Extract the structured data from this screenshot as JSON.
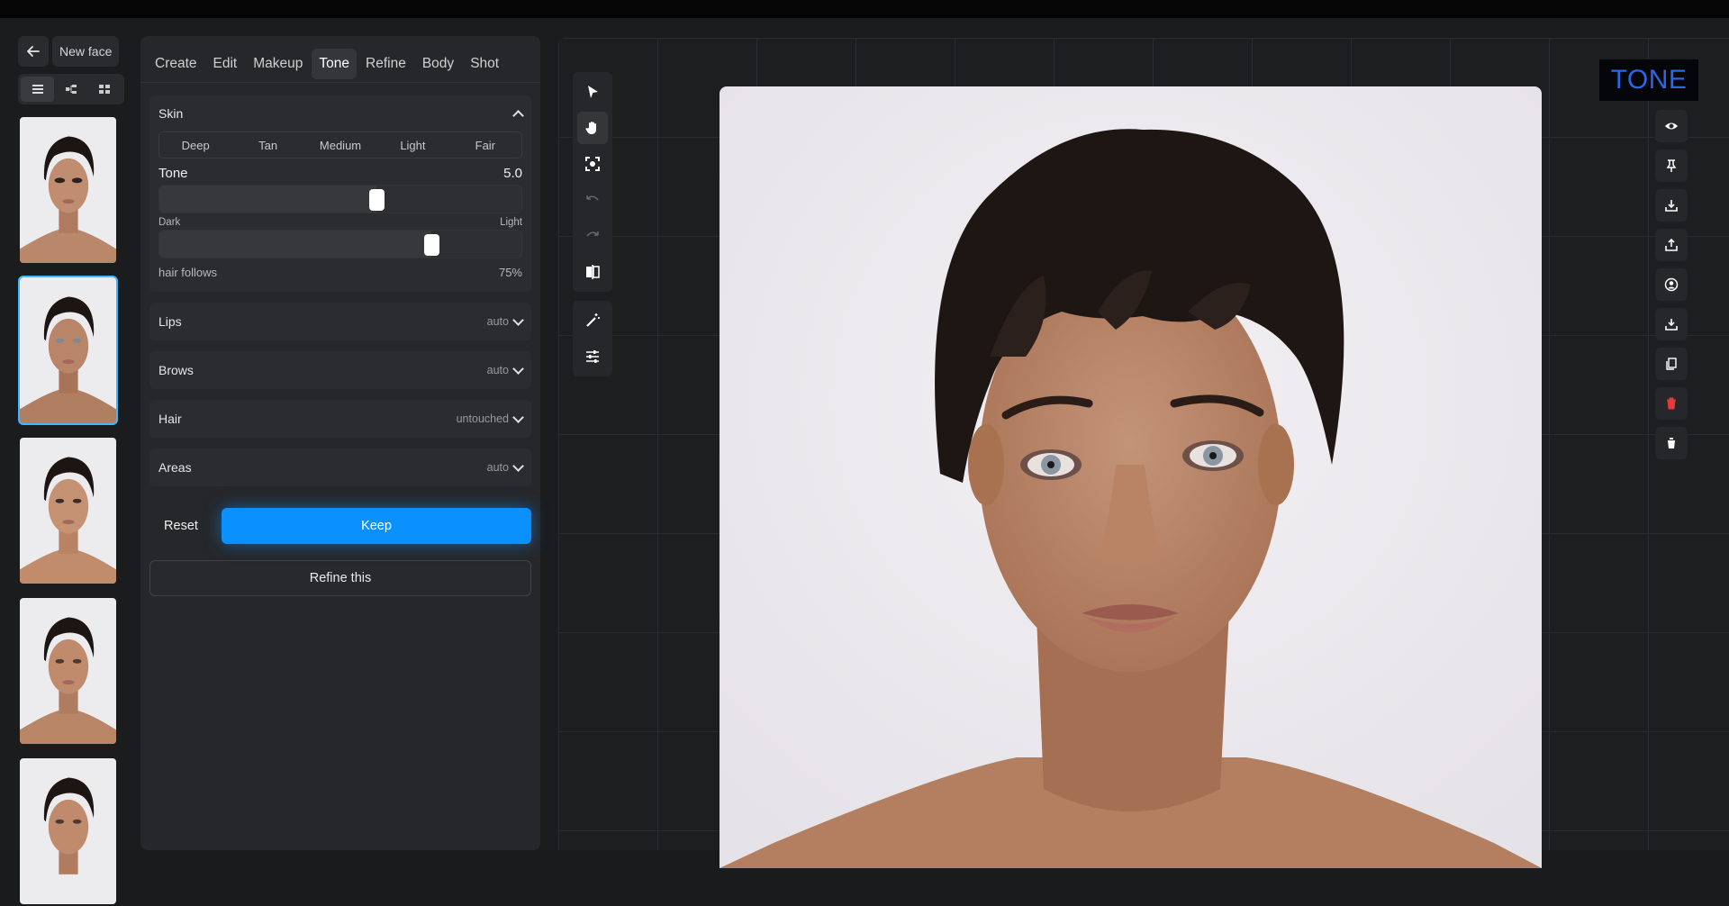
{
  "header": {
    "back_icon": "arrow-left-icon",
    "title": "New face"
  },
  "view_modes": [
    "list-view-icon",
    "tree-view-icon",
    "grid-view-icon"
  ],
  "thumbnails": [
    {
      "selected": false,
      "variant": "heavy eye makeup"
    },
    {
      "selected": true,
      "variant": "tone edit"
    },
    {
      "selected": false,
      "variant": "warm"
    },
    {
      "selected": false,
      "variant": "natural"
    },
    {
      "selected": false,
      "variant": "partial"
    }
  ],
  "tabs": [
    {
      "label": "Create",
      "active": false
    },
    {
      "label": "Edit",
      "active": false
    },
    {
      "label": "Makeup",
      "active": false
    },
    {
      "label": "Tone",
      "active": true
    },
    {
      "label": "Refine",
      "active": false
    },
    {
      "label": "Body",
      "active": false
    },
    {
      "label": "Shot",
      "active": false
    }
  ],
  "skin": {
    "title": "Skin",
    "presets": [
      "Deep",
      "Tan",
      "Medium",
      "Light",
      "Fair"
    ],
    "tone_label": "Tone",
    "tone_value": "5.0",
    "tone_fraction": 0.6,
    "range_min_label": "Dark",
    "range_max_label": "Light",
    "hair_follows_label": "hair follows",
    "hair_follows_value": "75%",
    "hair_follows_fraction": 0.75
  },
  "sections": [
    {
      "label": "Lips",
      "value": "auto"
    },
    {
      "label": "Brows",
      "value": "auto"
    },
    {
      "label": "Hair",
      "value": "untouched"
    },
    {
      "label": "Areas",
      "value": "auto"
    }
  ],
  "actions": {
    "reset": "Reset",
    "keep": "Keep",
    "refine": "Refine this"
  },
  "tools": [
    "select-arrow-icon",
    "hand-pan-icon",
    "focus-frame-icon",
    "undo-icon",
    "redo-icon",
    "compare-icon",
    "magic-wand-icon",
    "adjust-sliders-icon"
  ],
  "mode_badge": "TONE",
  "right_tools": [
    "eye-icon",
    "pin-icon",
    "download-icon",
    "share-icon",
    "profile-icon",
    "save-icon",
    "copy-icon",
    "delete-red-icon",
    "trash-icon"
  ],
  "colors": {
    "accent": "#0a90ff",
    "selected_border": "#3fb6ff",
    "badge_text": "#2a66e6",
    "danger": "#e03a3a"
  }
}
